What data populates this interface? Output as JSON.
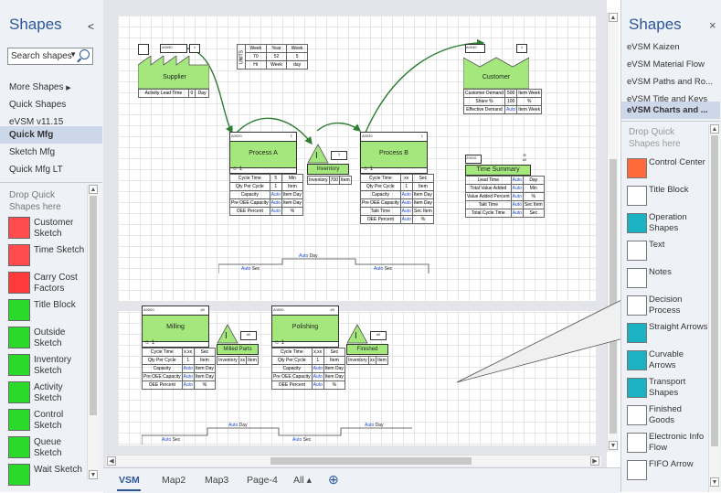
{
  "left_panel": {
    "title": "Shapes",
    "collapse_glyph": "<",
    "search_placeholder": "Search shapes",
    "nav": [
      "More Shapes",
      "Quick Shapes",
      "eVSM v11.15",
      "Quick Mfg",
      "Sketch Mfg",
      "Quick Mfg LT"
    ],
    "selected_nav": "Quick Mfg",
    "drop_hint": "Drop Quick Shapes here",
    "stencils": [
      {
        "label": "Customer Sketch",
        "icon": "customer-sketch-icon",
        "color": "#ff4d4d"
      },
      {
        "label": "Time Sketch",
        "icon": "time-sketch-icon",
        "color": "#ff4d4d"
      },
      {
        "label": "Carry Cost Factors",
        "icon": "carry-cost-icon",
        "color": "#ff3a3a"
      },
      {
        "label": "Title Block",
        "icon": "title-block-icon",
        "color": "#2bd92b"
      },
      {
        "label": "Outside Sketch",
        "icon": "outside-sketch-icon",
        "color": "#2bd92b"
      },
      {
        "label": "Inventory Sketch",
        "icon": "inventory-sketch-icon",
        "color": "#2bd92b"
      },
      {
        "label": "Activity Sketch",
        "icon": "activity-sketch-icon",
        "color": "#2bd92b"
      },
      {
        "label": "Control Sketch",
        "icon": "control-sketch-icon",
        "color": "#2bd92b"
      },
      {
        "label": "Queue Sketch",
        "icon": "queue-sketch-icon",
        "color": "#2bd92b"
      },
      {
        "label": "Wait Sketch",
        "icon": "wait-sketch-icon",
        "color": "#2bd92b"
      }
    ]
  },
  "right_panel": {
    "title": "Shapes",
    "close_glyph": "×",
    "items": [
      "eVSM Kaizen",
      "eVSM Material Flow",
      "eVSM Paths and Ro...",
      "eVSM Title and Keys",
      "eVSM Charts and ..."
    ],
    "selected": "eVSM Charts and ...",
    "drop_hint": "Drop Quick Shapes here",
    "stencils": [
      {
        "label": "Control Center",
        "icon": "control-center-icon"
      },
      {
        "label": "Title Block",
        "icon": "title-block-icon"
      },
      {
        "label": "Operation Shapes",
        "icon": "operation-shapes-icon"
      },
      {
        "label": "Text",
        "icon": "text-icon"
      },
      {
        "label": "Notes",
        "icon": "notes-icon"
      },
      {
        "label": "Decision Process",
        "icon": "decision-process-icon"
      },
      {
        "label": "Straight Arrows",
        "icon": "straight-arrows-icon"
      },
      {
        "label": "Curvable Arrows",
        "icon": "curvable-arrows-icon"
      },
      {
        "label": "Transport Shapes",
        "icon": "transport-shapes-icon"
      },
      {
        "label": "Finished Goods",
        "icon": "finished-goods-icon"
      },
      {
        "label": "Electronic Info Flow",
        "icon": "electronic-info-icon"
      },
      {
        "label": "FIFO Arrow",
        "icon": "fifo-arrow-icon"
      }
    ]
  },
  "canvas": {
    "supplier": {
      "title": "Supplier",
      "id": "A0050",
      "count": "1",
      "row_label": "Activity Lead Time",
      "row_value": "0",
      "row_unit": "Day"
    },
    "units_table": {
      "side": "UNITS",
      "rows": [
        [
          "Week",
          "Year",
          "Week"
        ],
        [
          "70",
          "52",
          "5"
        ],
        [
          "Hr",
          "Week",
          "day"
        ]
      ]
    },
    "customer": {
      "title": "Customer",
      "id": "A0040",
      "count": "1",
      "rows": [
        [
          "Customer Demand",
          "500",
          "Item Week"
        ],
        [
          "Share %",
          "100",
          "%"
        ],
        [
          "Effective Demand",
          "Auto",
          "Item Week"
        ]
      ]
    },
    "process_a": {
      "title": "Process A",
      "id": "A0020",
      "count": "1",
      "operators": "1",
      "rows": [
        [
          "Cycle Time",
          "5",
          "Min"
        ],
        [
          "Qty Per Cycle",
          "1",
          "Item"
        ],
        [
          "Capacity",
          "Auto",
          "Item Day"
        ],
        [
          "Pre OEE Capacity",
          "Auto",
          "Item Day"
        ],
        [
          "OEE Percent",
          "Auto",
          "%"
        ]
      ]
    },
    "inventory": {
      "title": "Inventory",
      "id": "A0070",
      "count": "1",
      "row": [
        "Inventory",
        "700",
        "Item"
      ]
    },
    "process_b": {
      "title": "Process B",
      "id": "A0030",
      "count": "1",
      "operators": "1",
      "rows": [
        [
          "Cycle Time",
          "xx",
          "Sec"
        ],
        [
          "Qty Per Cycle",
          "1",
          "Item"
        ],
        [
          "Capacity",
          "Auto",
          "Item Day"
        ],
        [
          "Pre OEE Capacity",
          "Auto",
          "Item Day"
        ],
        [
          "Takt Time",
          "Auto",
          "Sec Item"
        ],
        [
          "OEE Percent",
          "Auto",
          "%"
        ]
      ]
    },
    "time_summary": {
      "title": "Time Summary",
      "id": "Z0010",
      "count": "#0",
      "rows": [
        [
          "Lead Time",
          "Auto",
          "Day"
        ],
        [
          "Total Value Added",
          "Auto",
          "Min"
        ],
        [
          "Value Added Percent",
          "Auto",
          "%"
        ],
        [
          "Takt Time",
          "Auto",
          "Sec Item"
        ],
        [
          "Total Cycle Time",
          "Auto",
          "Sec"
        ]
      ]
    },
    "timeline_top": {
      "upper": [
        "Auto",
        "Day"
      ],
      "lower_a": [
        "Auto",
        "Sec"
      ],
      "lower_b": [
        "Auto",
        "Sec"
      ]
    },
    "milling": {
      "title": "Milling",
      "id": "A0000",
      "count": "#0",
      "operators": "1",
      "rows": [
        [
          "Cycle Time",
          "x.xx",
          "Sec"
        ],
        [
          "Qty Per Cycle",
          "1",
          "Item"
        ],
        [
          "Capacity",
          "Auto",
          "Item Day"
        ],
        [
          "Pre OEE Capacity",
          "Auto",
          "Item Day"
        ],
        [
          "OEE Percent",
          "Auto",
          "%"
        ]
      ]
    },
    "milled_parts": {
      "title": "Milled Parts",
      "id": "A0070",
      "count": "#0",
      "row": [
        "Inventory",
        "xx",
        "Item"
      ]
    },
    "polishing": {
      "title": "Polishing",
      "id": "A0000",
      "count": "#0",
      "operators": "1",
      "rows": [
        [
          "Cycle Time",
          "x.xx",
          "Sec"
        ],
        [
          "Qty Per Cycle",
          "1",
          "Item"
        ],
        [
          "Capacity",
          "Auto",
          "Item Day"
        ],
        [
          "Pre OEE Capacity",
          "Auto",
          "Item Day"
        ],
        [
          "OEE Percent",
          "Auto",
          "%"
        ]
      ]
    },
    "finished": {
      "title": "Finished",
      "id": "A0070",
      "count": "#0",
      "row": [
        "Inventory",
        "xx",
        "Item"
      ]
    },
    "timeline_bottom": {
      "upper_a": [
        "Auto",
        "Day"
      ],
      "upper_b": [
        "Auto",
        "Day"
      ],
      "lower_a": [
        "Auto",
        "Sec"
      ],
      "lower_b": [
        "Auto",
        "Sec"
      ]
    }
  },
  "tabs": {
    "items": [
      "VSM",
      "Map2",
      "Map3",
      "Page-4",
      "All ▴"
    ],
    "active": "VSM",
    "add_glyph": "⊕"
  },
  "colors": {
    "accent": "#2b579a",
    "process_green": "#a4e87d",
    "flow_arrow": "#2e7d32",
    "auto_text": "#1f4fd0"
  }
}
